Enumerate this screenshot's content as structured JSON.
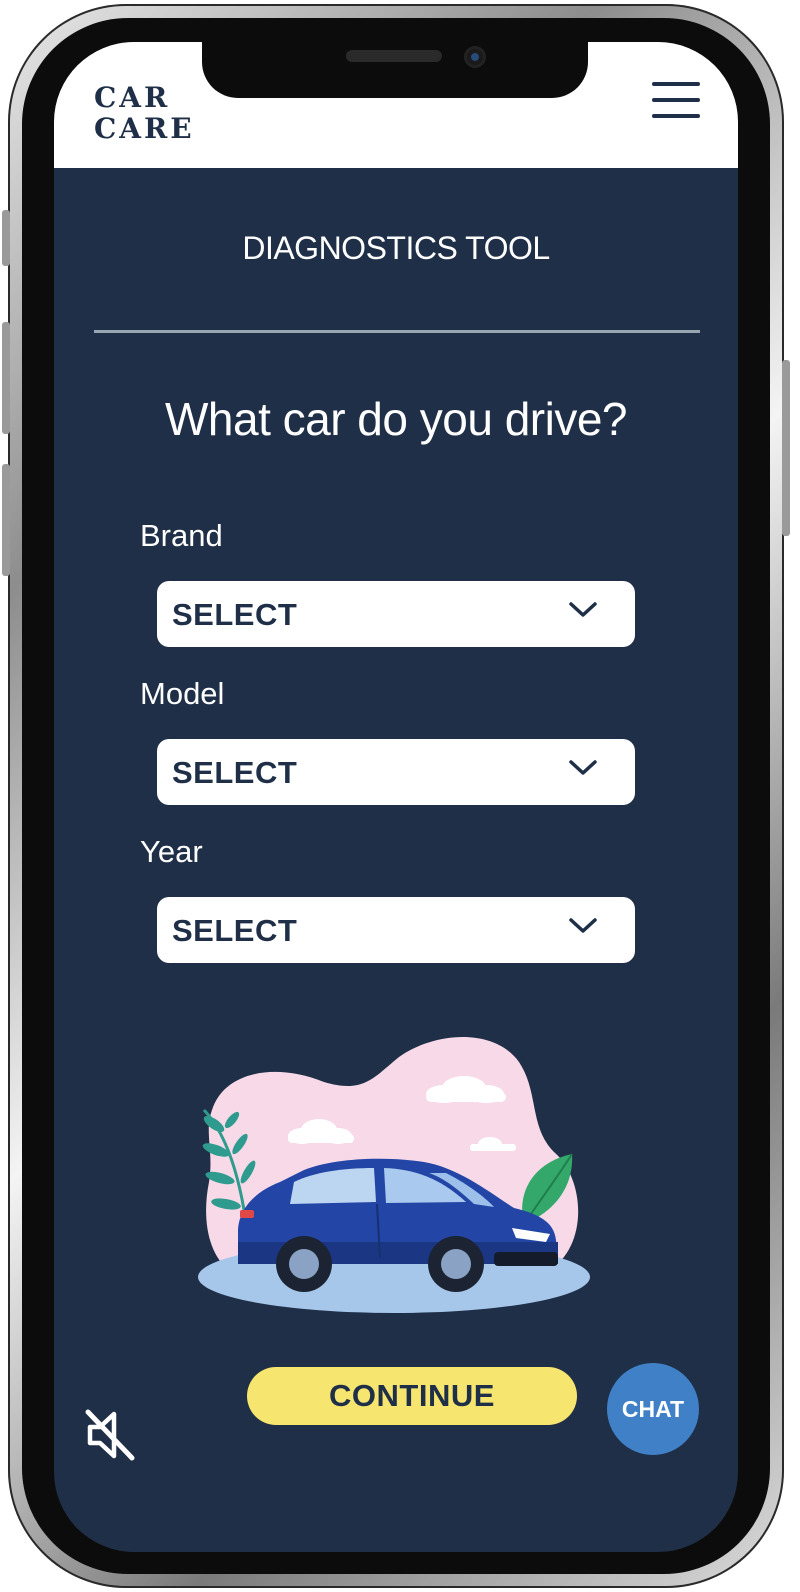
{
  "header": {
    "logo_line1": "CAR",
    "logo_line2": "CARE",
    "menu_icon": "hamburger-menu-icon"
  },
  "page": {
    "section_title": "DIAGNOSTICS TOOL",
    "question": "What car do you drive?"
  },
  "form": {
    "brand": {
      "label": "Brand",
      "value": "SELECT"
    },
    "model": {
      "label": "Model",
      "value": "SELECT"
    },
    "year": {
      "label": "Year",
      "value": "SELECT"
    }
  },
  "actions": {
    "continue_label": "CONTINUE",
    "chat_label": "CHAT",
    "mute_icon": "speaker-muted-icon"
  },
  "colors": {
    "background": "#1f2f47",
    "header": "#ffffff",
    "continue_button": "#f6e56e",
    "chat_button": "#3f80c6",
    "text_dark": "#1f2f47"
  }
}
